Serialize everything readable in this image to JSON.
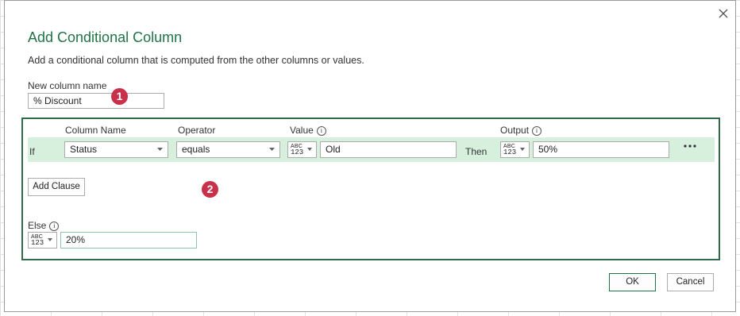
{
  "dialog": {
    "title": "Add Conditional Column",
    "description": "Add a conditional column that is computed from the other columns or values.",
    "new_column_label": "New column name",
    "new_column_value": "% Discount",
    "headers": {
      "column_name": "Column Name",
      "operator": "Operator",
      "value": "Value",
      "output": "Output"
    },
    "clause": {
      "if_label": "If",
      "column_name": "Status",
      "operator": "equals",
      "value_type": {
        "abc": "ABC",
        "num": "123"
      },
      "value": "Old",
      "then_label": "Then",
      "output_type": {
        "abc": "ABC",
        "num": "123"
      },
      "output": "50%"
    },
    "add_clause_label": "Add Clause",
    "else_label": "Else",
    "else_type": {
      "abc": "ABC",
      "num": "123"
    },
    "else_value": "20%",
    "ok_label": "OK",
    "cancel_label": "Cancel",
    "info_glyph": "i"
  },
  "annotations": {
    "badge_1": "1",
    "badge_2": "2",
    "color": "#c8314a"
  },
  "colors": {
    "title": "#217346",
    "clause_row_bg": "#d7f0de",
    "clause_box_border": "#2e6b48"
  },
  "icons": {
    "close": "close-icon",
    "dropdown": "chevron-down-icon",
    "info": "info-icon",
    "more": "more-horizontal-icon"
  }
}
